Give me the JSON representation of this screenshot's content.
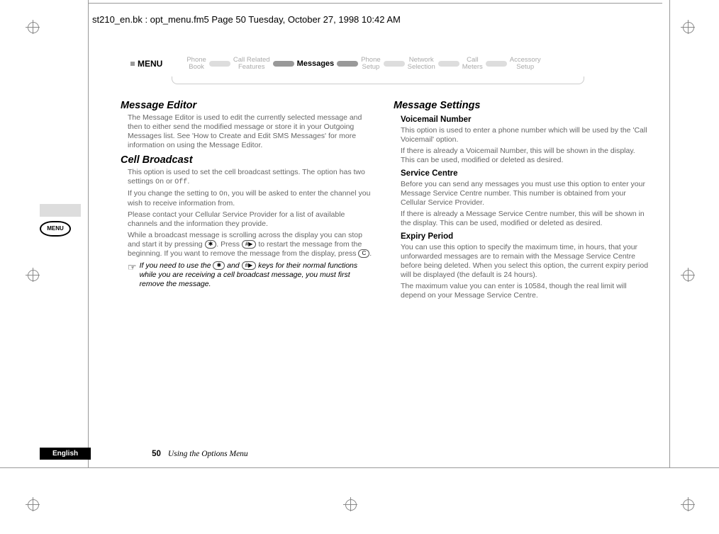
{
  "header_line": "st210_en.bk : opt_menu.fm5  Page 50  Tuesday, October 27, 1998  10:42 AM",
  "nav": {
    "menu_label": "MENU",
    "items": [
      {
        "l1": "Phone",
        "l2": "Book"
      },
      {
        "l1": "Call Related",
        "l2": "Features"
      },
      {
        "l1": "Messages",
        "l2": ""
      },
      {
        "l1": "Phone",
        "l2": "Setup"
      },
      {
        "l1": "Network",
        "l2": "Selection"
      },
      {
        "l1": "Call",
        "l2": "Meters"
      },
      {
        "l1": "Accessory",
        "l2": "Setup"
      }
    ],
    "active_index": 2
  },
  "menu_button_label": "MENU",
  "left": {
    "s1_title": "Message Editor",
    "s1_p1": "The Message Editor is used to edit the currently selected message and then to either send the modified message or store it in your Outgoing Messages list. See 'How to Create and Edit SMS Messages' for more information on using the Message Editor.",
    "s2_title": "Cell Broadcast",
    "s2_p1_a": "This option is used to set the cell broadcast settings. The option has two settings ",
    "s2_p1_on": "On",
    "s2_p1_b": " or ",
    "s2_p1_off": "Off",
    "s2_p1_c": ".",
    "s2_p2_a": "If you change the setting to ",
    "s2_p2_on": "On",
    "s2_p2_b": ", you will be asked to enter the channel you wish to receive information from.",
    "s2_p3": "Please contact your Cellular Service Provider for a list of available channels and the information they provide.",
    "s2_p4_a": "While a broadcast message is scrolling across the display you can stop and start it by pressing ",
    "s2_p4_key1": "✱",
    "s2_p4_b": ". Press ",
    "s2_p4_key2": "#▶",
    "s2_p4_c": " to restart the message from the beginning. If you want to remove the message from the display, press ",
    "s2_p4_key3": "C",
    "s2_p4_d": ".",
    "note_icon": "☞",
    "note_a": "If you need to use the ",
    "note_key1": "✱",
    "note_b": " and ",
    "note_key2": "#▶",
    "note_c": " keys for their normal functions while you are receiving a cell broadcast message, you must first remove the message."
  },
  "right": {
    "s1_title": "Message Settings",
    "sub1": "Voicemail Number",
    "sub1_p1": "This option is used to enter a phone number which will be used by the 'Call Voicemail' option.",
    "sub1_p2": "If there is already a Voicemail Number, this will be shown in the display. This can be used, modified or deleted as desired.",
    "sub2": "Service Centre",
    "sub2_p1": "Before you can send any messages you must use this option to enter your Message Service Centre number. This number is obtained from your Cellular Service Provider.",
    "sub2_p2": "If there is already a Message Service Centre number, this will be shown in the display. This can be used, modified or deleted as desired.",
    "sub3": "Expiry Period",
    "sub3_p1": "You can use this option to specify the maximum time, in hours, that your unforwarded messages are to remain with the Message Service Centre before being deleted. When you select this option, the current expiry period will be displayed (the default is 24 hours).",
    "sub3_p2": "The maximum value you can enter is 10584, though the real limit will depend on your Message Service Centre."
  },
  "footer": {
    "language": "English",
    "page": "50",
    "title": "Using the Options Menu"
  }
}
